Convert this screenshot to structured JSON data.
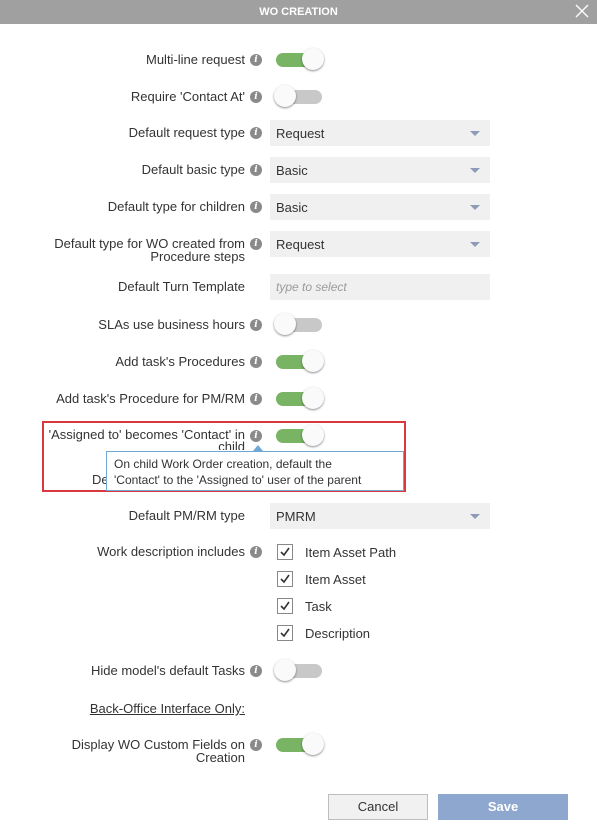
{
  "dialog": {
    "title": "WO CREATION"
  },
  "fields": {
    "multi_line_request": {
      "label": "Multi-line request",
      "on": true
    },
    "require_contact_at": {
      "label": "Require 'Contact At'",
      "on": false
    },
    "default_request_type": {
      "label": "Default request type",
      "value": "Request"
    },
    "default_basic_type": {
      "label": "Default basic type",
      "value": "Basic"
    },
    "default_type_children": {
      "label": "Default type for children",
      "value": "Basic"
    },
    "default_type_procedure": {
      "label_line1": "Default type for WO created from",
      "label_line2": "Procedure steps",
      "value": "Request"
    },
    "default_turn_template": {
      "label": "Default Turn Template",
      "placeholder": "type to select"
    },
    "sla_business_hours": {
      "label": "SLAs use business hours",
      "on": false
    },
    "add_task_procedures": {
      "label": "Add task's Procedures",
      "on": true
    },
    "add_task_procedure_pmrm": {
      "label": "Add task's Procedure for PM/RM",
      "on": true
    },
    "assigned_becomes_contact": {
      "label_line1": "'Assigned to' becomes 'Contact' in",
      "label_line2": "child",
      "on": true
    },
    "hidden_label_fragment": "De",
    "default_pmrm_type": {
      "label": "Default PM/RM type",
      "value": "PMRM"
    },
    "work_description": {
      "label": "Work description includes",
      "options": [
        "Item Asset Path",
        "Item Asset",
        "Task",
        "Description"
      ]
    },
    "hide_default_tasks": {
      "label": "Hide model's default Tasks",
      "on": false
    },
    "back_office_link": "Back-Office Interface Only:",
    "display_custom_fields": {
      "label_line1": "Display WO Custom Fields on",
      "label_line2": "Creation",
      "on": true
    }
  },
  "tooltip": {
    "line1": "On child Work Order creation, default the",
    "line2": "'Contact' to the 'Assigned to' user of the parent"
  },
  "buttons": {
    "cancel": "Cancel",
    "save": "Save"
  },
  "info_glyph": "i"
}
